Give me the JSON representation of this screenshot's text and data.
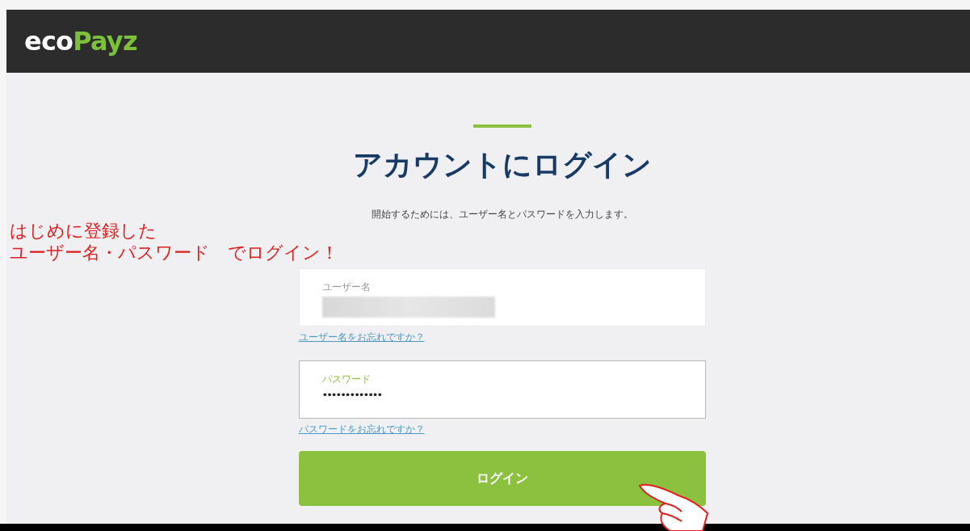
{
  "header": {
    "logo": {
      "first": "eco",
      "second": "Payz"
    }
  },
  "login": {
    "title": "アカウントにログイン",
    "subtitle": "開始するためには、ユーザー名とパスワードを入力します。",
    "fields": [
      {
        "kind": "username",
        "label": "ユーザー名",
        "focused": false,
        "link": "ユーザー名をお忘れですか？"
      },
      {
        "kind": "password",
        "label": "パスワード",
        "value": "•••••••••••••",
        "focused": true,
        "link": "パスワードをお忘れですか？"
      }
    ],
    "button": "ログイン"
  },
  "annotation": {
    "lines": [
      "はじめに登録した",
      "ユーザー名・パスワード　でログイン！"
    ]
  }
}
